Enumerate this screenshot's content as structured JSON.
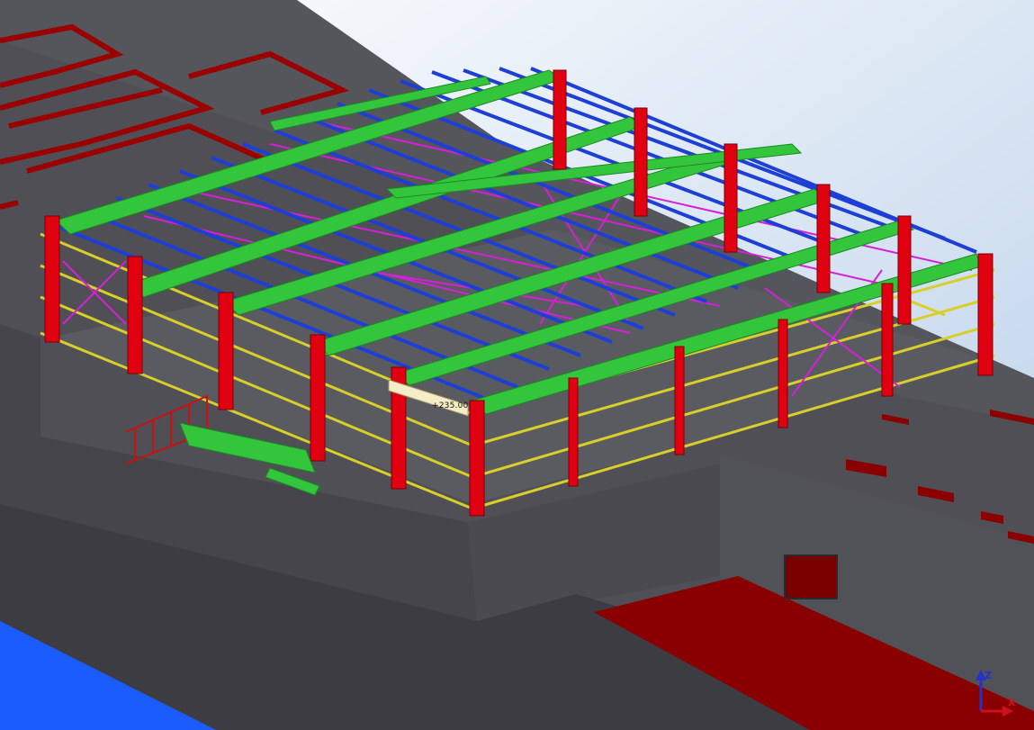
{
  "viewport": {
    "dimension_label": "+235.00",
    "axis_labels": {
      "z": "Z",
      "x": "X"
    }
  },
  "colors": {
    "sky_top": "#ffffff",
    "sky_bottom": "#b8cfe9",
    "concrete": "#4f4f55",
    "concrete_dark": "#3f3f45",
    "concrete_light": "#5c5c63",
    "slab_red": "#8a0000",
    "water_blue": "#1a5cff",
    "column_red": "#e00010",
    "rafter_green": "#33c63c",
    "purlin_blue": "#1d3fd6",
    "bracing_magenta": "#d61fd6",
    "girt_yellow": "#d9cf2a",
    "axis_z": "#2233cc",
    "axis_x": "#cc1122"
  },
  "icons": [
    "coordinate-axis-icon"
  ]
}
